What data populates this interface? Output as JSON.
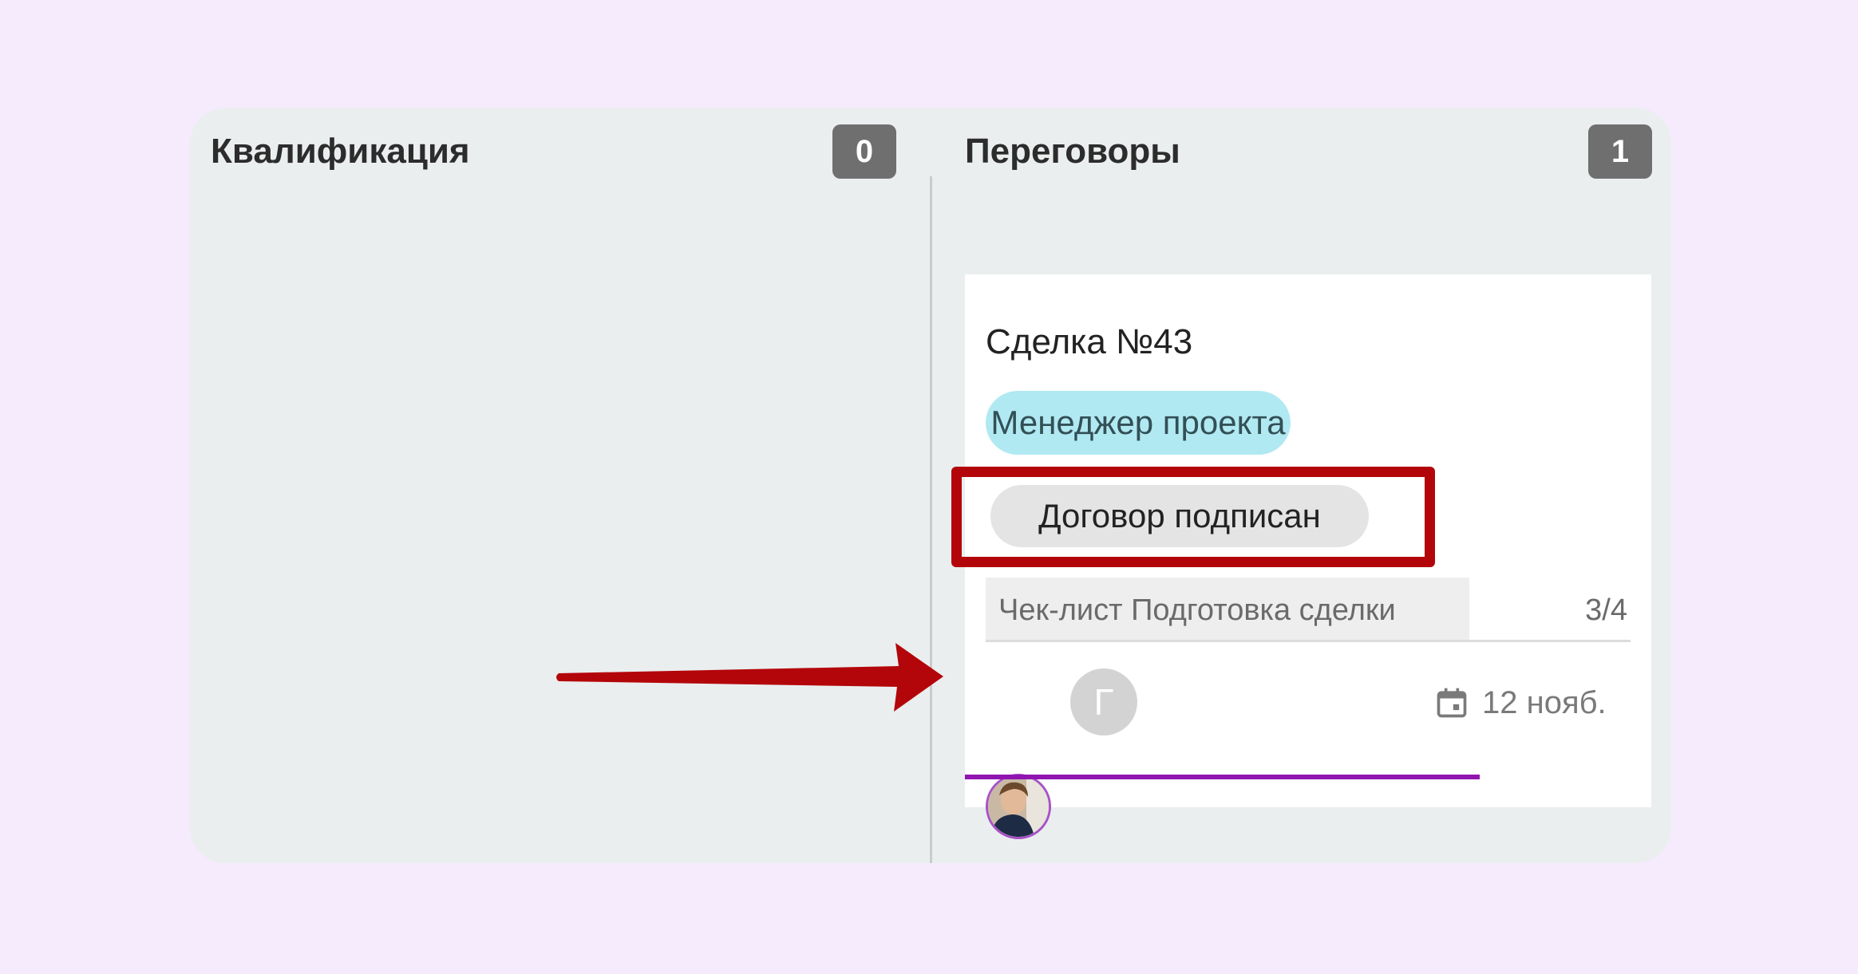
{
  "board": {
    "columns": [
      {
        "title": "Квалификация",
        "count": "0"
      },
      {
        "title": "Переговоры",
        "count": "1"
      }
    ]
  },
  "card": {
    "title": "Сделка №43",
    "tags": [
      {
        "label": "Менеджер проекта",
        "color": "#b1e9f2"
      },
      {
        "label": "Договор подписан",
        "color": "#e4e4e4"
      }
    ],
    "checklist": {
      "label": "Чек-лист Подготовка сделки",
      "progress": "3/4",
      "progress_fraction": 0.75
    },
    "assignees": [
      {
        "type": "photo",
        "icon": "user-photo-avatar"
      },
      {
        "type": "initial",
        "initial": "Г"
      }
    ],
    "due_date": "12 нояб.",
    "due_icon": "calendar-icon",
    "accent_color": "#9015b0"
  },
  "annotations": {
    "highlight_color": "#b3060a",
    "arrow_color": "#b3060a"
  }
}
